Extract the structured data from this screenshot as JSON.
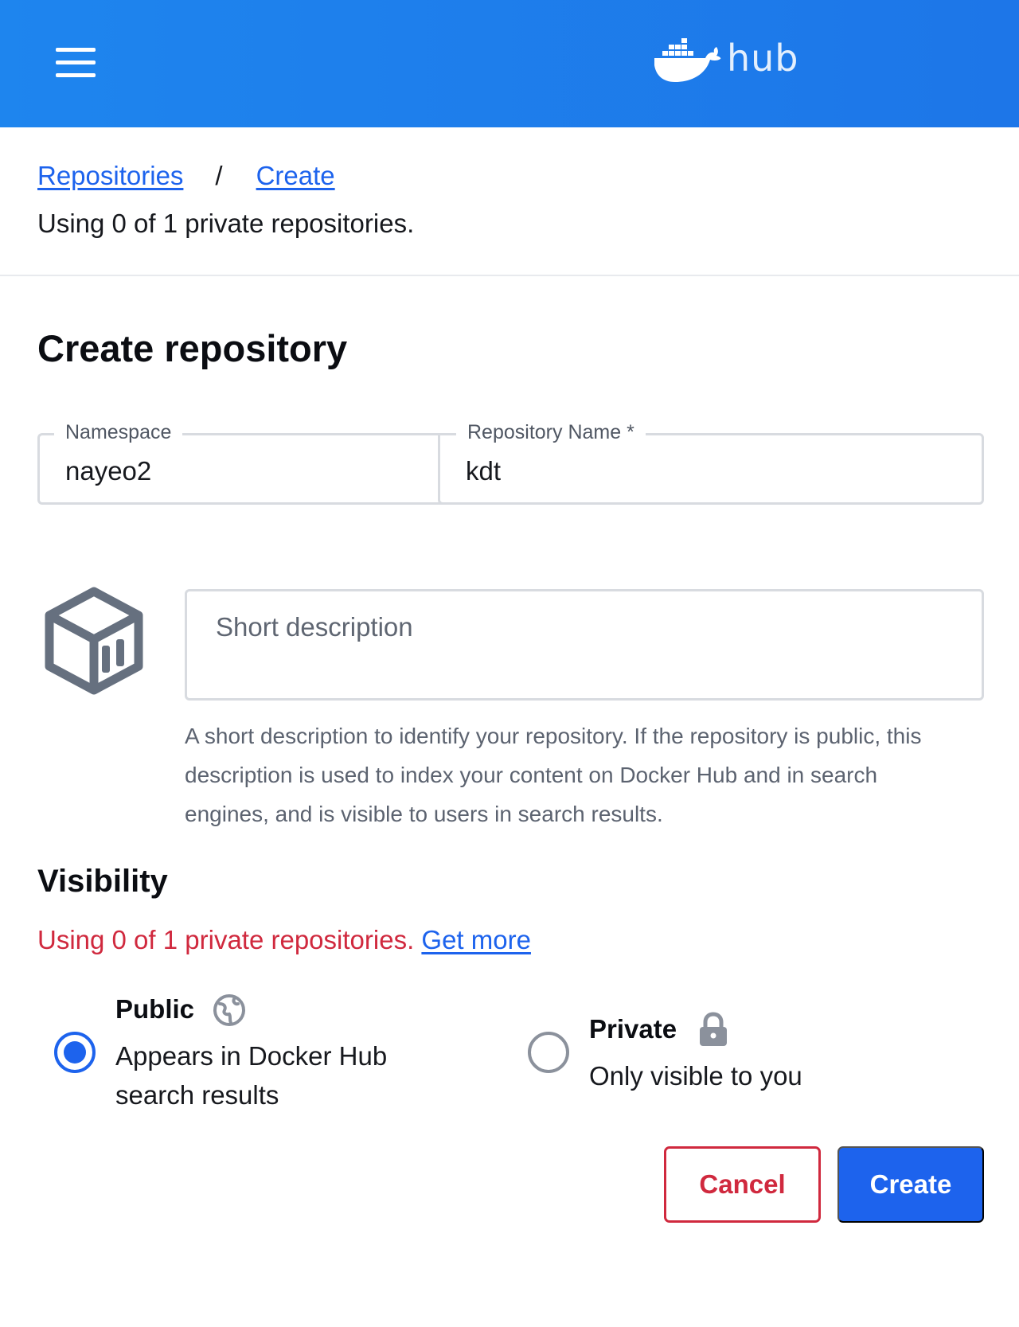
{
  "header": {
    "logo_text": "hub",
    "menu_icon": "hamburger-menu-icon",
    "logo_icon": "docker-whale-icon",
    "background_color": "#1e85ee"
  },
  "breadcrumb": {
    "items": [
      "Repositories",
      "Create"
    ],
    "separator": "/"
  },
  "usage_text": "Using 0 of 1 private repositories.",
  "page_title": "Create repository",
  "form": {
    "namespace": {
      "label": "Namespace",
      "value": "nayeo2"
    },
    "repository_name": {
      "label": "Repository Name *",
      "value": "kdt"
    },
    "short_description": {
      "placeholder": "Short description",
      "value": "",
      "help": "A short description to identify your repository. If the repository is public, this description is used to index your content on Docker Hub and in search engines, and is visible to users in search results."
    }
  },
  "visibility": {
    "title": "Visibility",
    "usage_text": "Using 0 of 1 private repositories.",
    "get_more": "Get more",
    "options": [
      {
        "title": "Public",
        "description": "Appears in Docker Hub search results",
        "selected": true,
        "icon": "globe-icon"
      },
      {
        "title": "Private",
        "description": "Only visible to you",
        "selected": false,
        "icon": "lock-icon"
      }
    ]
  },
  "buttons": {
    "cancel": "Cancel",
    "create": "Create"
  },
  "colors": {
    "accent": "#1d63ed",
    "danger": "#d0293e"
  }
}
